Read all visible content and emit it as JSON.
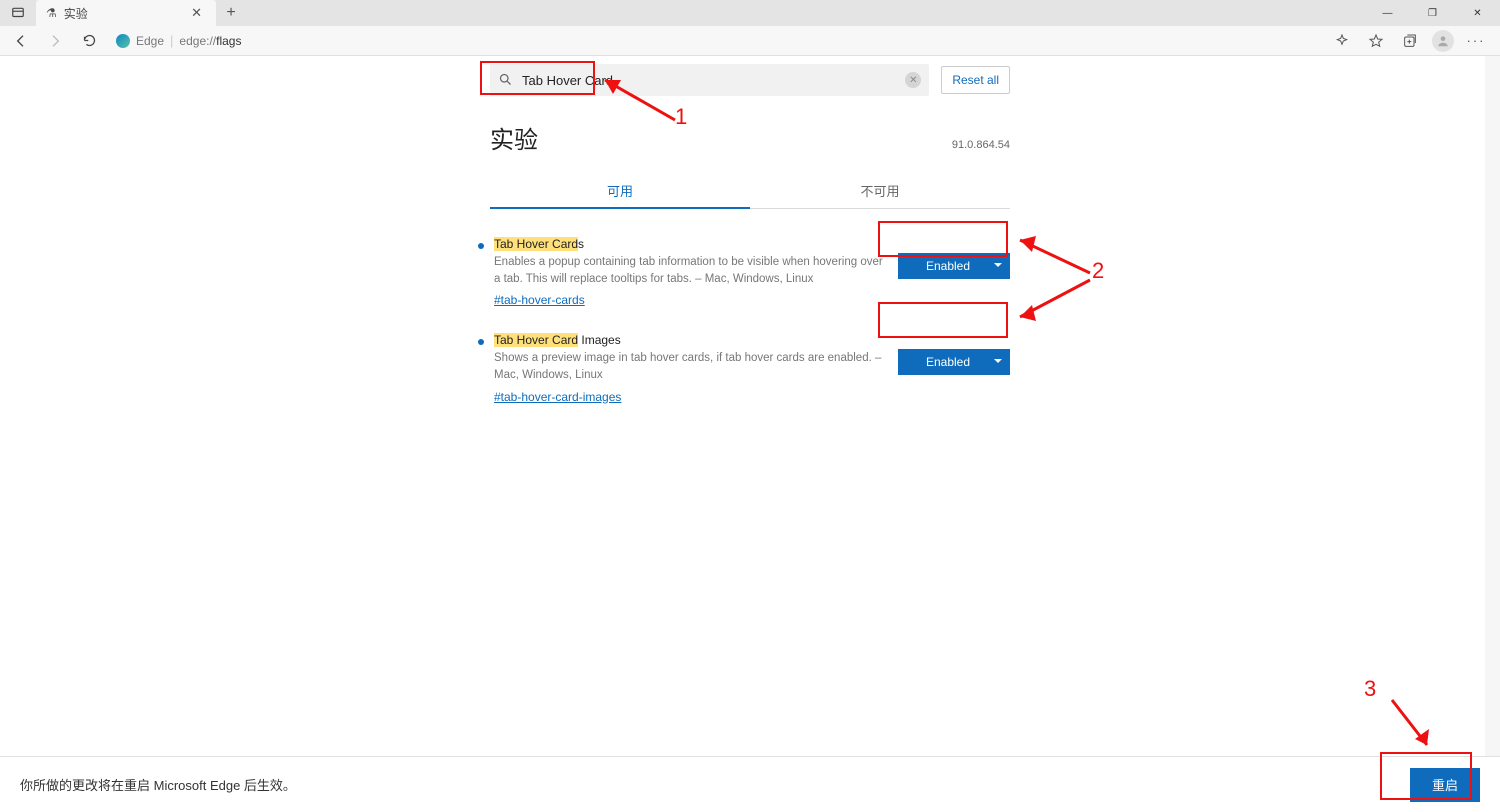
{
  "window": {
    "tab_title": "实验"
  },
  "nav": {
    "origin_label": "Edge",
    "url_scheme": "edge://",
    "url_rest": "flags"
  },
  "page": {
    "search_value": "Tab Hover Card",
    "reset_label": "Reset all",
    "heading": "实验",
    "version": "91.0.864.54",
    "tabs": {
      "available": "可用",
      "unavailable": "不可用"
    }
  },
  "flags": [
    {
      "title_hl": "Tab Hover Card",
      "title_rest": "s",
      "desc": "Enables a popup containing tab information to be visible when hovering over a tab. This will replace tooltips for tabs. – Mac, Windows, Linux",
      "link": "#tab-hover-cards",
      "value": "Enabled"
    },
    {
      "title_hl": "Tab Hover Card",
      "title_rest": " Images",
      "desc": "Shows a preview image in tab hover cards, if tab hover cards are enabled. – Mac, Windows, Linux",
      "link": "#tab-hover-card-images",
      "value": "Enabled"
    }
  ],
  "footer": {
    "message": "你所做的更改将在重启 Microsoft Edge 后生效。",
    "restart": "重启"
  },
  "annotations": {
    "n1": "1",
    "n2": "2",
    "n3": "3"
  }
}
